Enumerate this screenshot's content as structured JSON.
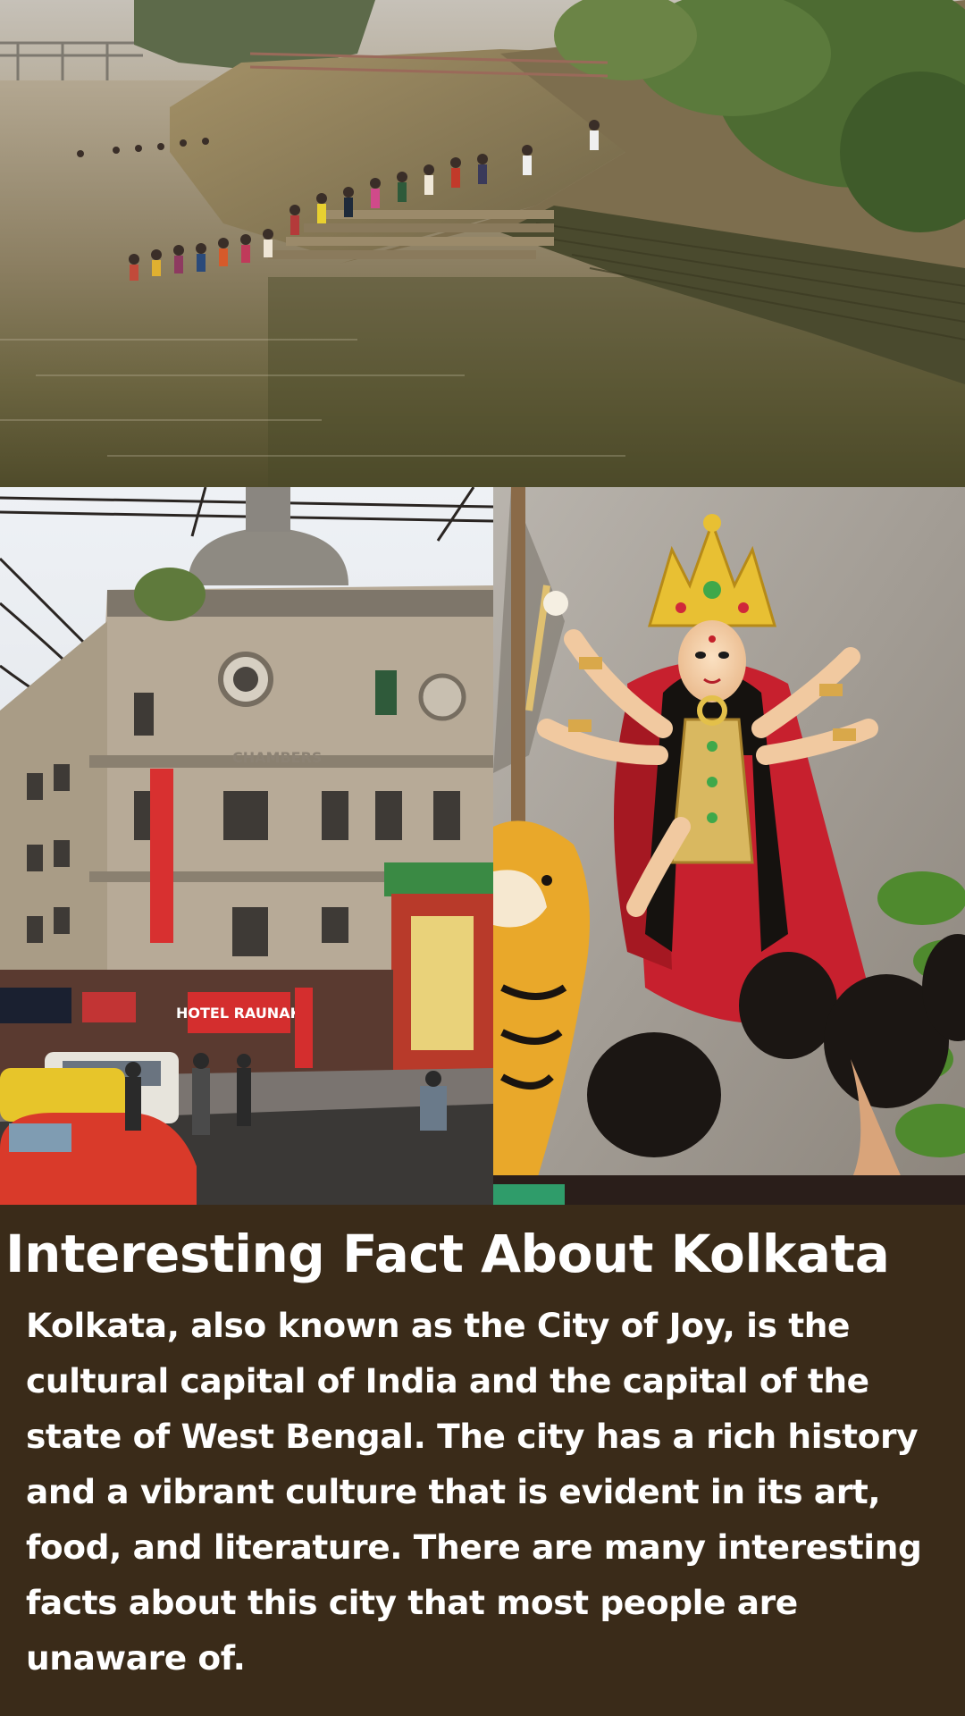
{
  "images": {
    "top": "kolkata-river-ghat-photo",
    "left": "kolkata-heritage-building-photo",
    "right": "durga-idol-photo"
  },
  "signage": {
    "hotel_name": "HOTEL RAUNAK",
    "vertical_sign": "HOTEL RAUNAK",
    "building_name": "CHAMBERS"
  },
  "article": {
    "title": "Interesting Fact About Kolkata",
    "body": "Kolkata, also known as the City of Joy, is the cultural capital of India and the capital of the state of West Bengal. The city has a rich history and a vibrant culture that is evident in its art, food, and literature. There are many interesting facts about this city that most people are unaware of."
  },
  "colors": {
    "panel_background": "#3a2b19",
    "text": "#ffffff"
  }
}
